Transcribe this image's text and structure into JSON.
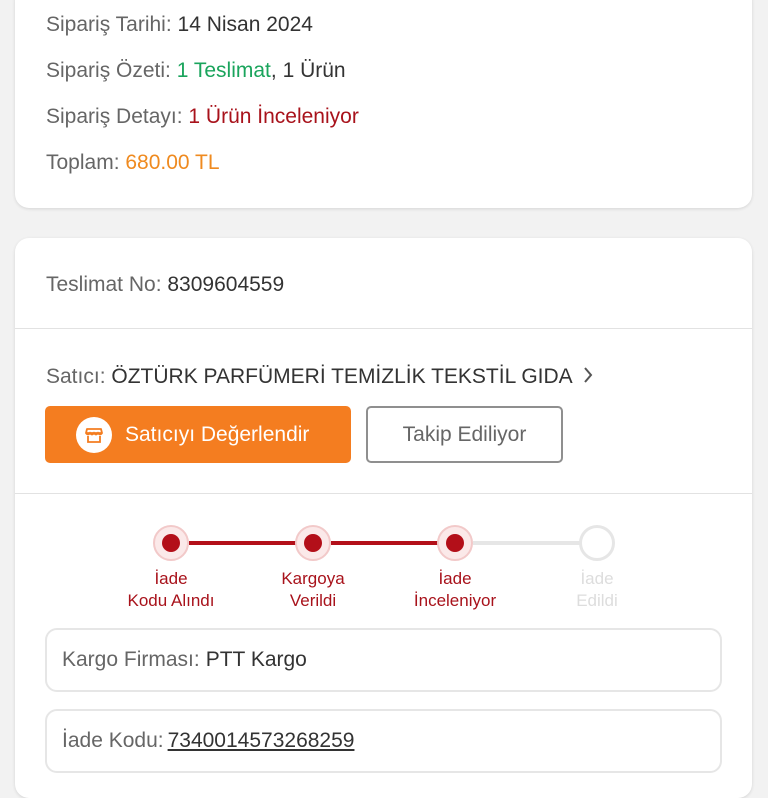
{
  "summary": {
    "date_label": "Sipariş Tarihi:",
    "date_value": "14 Nisan 2024",
    "overview_label": "Sipariş Özeti:",
    "overview_delivery": "1 Teslimat",
    "overview_separator": ",",
    "overview_items": "1 Ürün",
    "detail_label": "Sipariş Detayı:",
    "detail_value": "1 Ürün İnceleniyor",
    "total_label": "Toplam:",
    "total_value": "680.00 TL"
  },
  "delivery": {
    "number_label": "Teslimat No:",
    "number_value": "8309604559",
    "seller_label": "Satıcı:",
    "seller_name": "ÖZTÜRK PARFÜMERİ TEMİZLİK TEKSTİL GIDA",
    "rate_button": "Satıcıyı Değerlendir",
    "follow_button": "Takip Ediliyor",
    "steps": [
      {
        "label": "İade\nKodu Alındı",
        "status": "done"
      },
      {
        "label": "Kargoya\nVerildi",
        "status": "done"
      },
      {
        "label": "İade\nİnceleniyor",
        "status": "done"
      },
      {
        "label": "İade\nEdildi",
        "status": "pending"
      }
    ],
    "cargo_label": "Kargo Firması:",
    "cargo_value": "PTT Kargo",
    "return_code_label": "İade Kodu:",
    "return_code_value": "7340014573268259"
  },
  "colors": {
    "accent_orange": "#f47d20",
    "success_green": "#1aa45c",
    "status_red": "#a8121b",
    "total_orange": "#ef8a1f",
    "pending_gray": "#dddddd"
  },
  "icons": {
    "rate_button_icon": "store-icon",
    "seller_chevron": "chevron-right-icon"
  }
}
